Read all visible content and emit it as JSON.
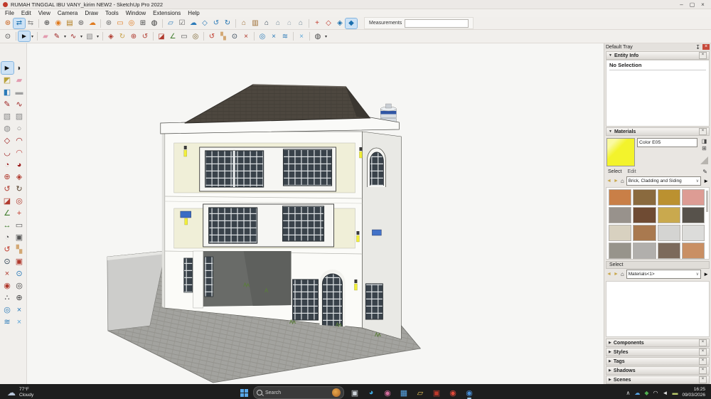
{
  "window": {
    "title": "RUMAH TINGGAL IBU VANY_kirim NEW2 - SketchUp Pro 2022",
    "controls": {
      "minimize": "–",
      "maximize": "▢",
      "close": "×"
    }
  },
  "menu": {
    "items": [
      {
        "name": "menu-file",
        "label": "File"
      },
      {
        "name": "menu-edit",
        "label": "Edit"
      },
      {
        "name": "menu-view",
        "label": "View"
      },
      {
        "name": "menu-camera",
        "label": "Camera"
      },
      {
        "name": "menu-draw",
        "label": "Draw"
      },
      {
        "name": "menu-tools",
        "label": "Tools"
      },
      {
        "name": "menu-window",
        "label": "Window"
      },
      {
        "name": "menu-extensions",
        "label": "Extensions"
      },
      {
        "name": "menu-help",
        "label": "Help"
      }
    ]
  },
  "toolbar_top": {
    "icons": [
      {
        "name": "extension-gear-icon",
        "glyph": "⊛",
        "color": "#c75b12"
      },
      {
        "name": "swap-arrows-icon",
        "glyph": "⇄",
        "color": "#1a6fae",
        "active": true
      },
      {
        "name": "send-to-layout-icon",
        "glyph": "⇆",
        "color": "#8a8a8a"
      },
      {
        "sep": true
      },
      {
        "name": "add-location-icon",
        "glyph": "⊕",
        "color": "#333333"
      },
      {
        "name": "geo-model-icon",
        "glyph": "◉",
        "color": "#e07b1f"
      },
      {
        "name": "styles-book-icon",
        "glyph": "▤",
        "color": "#b07818"
      },
      {
        "name": "model-info-icon",
        "glyph": "⊛",
        "color": "#555555"
      },
      {
        "name": "cloud-upload-icon",
        "glyph": "☁",
        "color": "#e07b1f"
      },
      {
        "sep": true
      },
      {
        "name": "manage-extensions-icon",
        "glyph": "⊛",
        "color": "#666666"
      },
      {
        "name": "feedback-chat-icon",
        "glyph": "▭",
        "color": "#e07b1f"
      },
      {
        "name": "warehouse-icon",
        "glyph": "◎",
        "color": "#e07b1f"
      },
      {
        "name": "cart-icon",
        "glyph": "⊞",
        "color": "#444444"
      },
      {
        "name": "account-icon",
        "glyph": "◍",
        "color": "#333333"
      },
      {
        "sep": true
      },
      {
        "name": "open-folder-icon",
        "glyph": "▱",
        "color": "#2a7ab8"
      },
      {
        "name": "checkbox-icon",
        "glyph": "☑",
        "color": "#666666"
      },
      {
        "name": "cloud-download-icon",
        "glyph": "☁",
        "color": "#2a7ab8"
      },
      {
        "name": "cloud-box-icon",
        "glyph": "◇",
        "color": "#2a7ab8"
      },
      {
        "name": "cloud-sync-icon",
        "glyph": "↺",
        "color": "#2a7ab8"
      },
      {
        "name": "refresh-icon",
        "glyph": "↻",
        "color": "#1a6fae"
      },
      {
        "sep": true
      },
      {
        "name": "textured-house-icon",
        "glyph": "⌂",
        "color": "#9c6a2f"
      },
      {
        "name": "component-book-icon",
        "glyph": "▥",
        "color": "#9c6a2f"
      },
      {
        "name": "house-solid-icon",
        "glyph": "⌂",
        "color": "#2c3e50"
      },
      {
        "name": "house-roof-icon",
        "glyph": "⌂",
        "color": "#6f8797"
      },
      {
        "name": "house-outline-icon",
        "glyph": "⌂",
        "color": "#9aa7b0"
      },
      {
        "name": "house-flat-icon",
        "glyph": "⌂",
        "color": "#6f8797"
      },
      {
        "sep": true
      },
      {
        "name": "axes-icon",
        "glyph": "+",
        "color": "#c0392b"
      },
      {
        "name": "face-wireframe-icon",
        "glyph": "◇",
        "color": "#c0392b"
      },
      {
        "name": "face-shaded-icon",
        "glyph": "◈",
        "color": "#1a6fae"
      },
      {
        "name": "face-textured-icon",
        "glyph": "◆",
        "color": "#1a6fae",
        "active": true
      }
    ],
    "measurements_label": "Measurements",
    "measurements_value": ""
  },
  "toolbar_second": {
    "icons": [
      {
        "name": "zoom-tool-icon",
        "glyph": "⊙",
        "color": "#444444"
      },
      {
        "sep": true
      },
      {
        "name": "select-arrow-icon",
        "glyph": "►",
        "color": "#111111",
        "active": true
      },
      {
        "name": "select-caret-icon",
        "glyph": "▾",
        "color": "#333333",
        "small": true
      },
      {
        "sep": true
      },
      {
        "name": "eraser-icon",
        "glyph": "▰",
        "color": "#e39cb0"
      },
      {
        "name": "pencil-icon",
        "glyph": "✎",
        "color": "#9b1c1c"
      },
      {
        "name": "pencil-caret-icon",
        "glyph": "▾",
        "color": "#333333",
        "small": true
      },
      {
        "name": "freehand-icon",
        "glyph": "∿",
        "color": "#9b1c1c"
      },
      {
        "name": "freehand-caret-icon",
        "glyph": "▾",
        "color": "#333333",
        "small": true
      },
      {
        "name": "rectangle-icon",
        "glyph": "▧",
        "color": "#8a8a8a"
      },
      {
        "name": "rectangle-caret-icon",
        "glyph": "▾",
        "color": "#333333",
        "small": true
      },
      {
        "sep": true
      },
      {
        "name": "pushpull-icon",
        "glyph": "◈",
        "color": "#b03a2e"
      },
      {
        "name": "followme-icon",
        "glyph": "↻",
        "color": "#c8a24a"
      },
      {
        "name": "move-icon",
        "glyph": "⊕",
        "color": "#b03a2e"
      },
      {
        "name": "rotate-icon",
        "glyph": "↺",
        "color": "#b03a2e"
      },
      {
        "sep": true
      },
      {
        "name": "scale-icon",
        "glyph": "◪",
        "color": "#b03a2e"
      },
      {
        "name": "tape-measure-icon",
        "glyph": "∠",
        "color": "#3f7d2c"
      },
      {
        "name": "text-label-icon",
        "glyph": "▭",
        "color": "#555555"
      },
      {
        "name": "binoculars-icon",
        "glyph": "◎",
        "color": "#7a6430"
      },
      {
        "sep": true
      },
      {
        "name": "orbit-icon",
        "glyph": "↺",
        "color": "#c0392b"
      },
      {
        "name": "pan-icon",
        "glyph": "▚",
        "color": "#d3a874"
      },
      {
        "name": "zoom-icon",
        "glyph": "⊙",
        "color": "#2c3e50"
      },
      {
        "name": "zoom-extents-icon",
        "glyph": "×",
        "color": "#b03a2e"
      },
      {
        "sep": true
      },
      {
        "name": "zoom-selection-icon",
        "glyph": "◎",
        "color": "#2a7ab8"
      },
      {
        "name": "section-tool-icon",
        "glyph": "×",
        "color": "#2a7ab8"
      },
      {
        "name": "layers-stack-icon",
        "glyph": "≋",
        "color": "#2a7ab8"
      },
      {
        "sep": true
      },
      {
        "name": "section-fill-icon",
        "glyph": "×",
        "color": "#5da6d8"
      },
      {
        "sep": true
      },
      {
        "name": "account-menu-icon",
        "glyph": "◍",
        "color": "#444444"
      },
      {
        "name": "account-caret-icon",
        "glyph": "▾",
        "color": "#333333",
        "small": true
      }
    ]
  },
  "left_toolbar": {
    "icons": [
      {
        "name": "select-arrow-icon",
        "glyph": "►",
        "color": "#111111",
        "active": true
      },
      {
        "name": "lasso-select-icon",
        "glyph": "◗",
        "color": "#333333"
      },
      {
        "name": "paint-bucket-icon",
        "glyph": "◩",
        "color": "#b9a23a"
      },
      {
        "name": "eraser-icon",
        "glyph": "▰",
        "color": "#e39cb0"
      },
      {
        "name": "sample-paint-icon",
        "glyph": "◧",
        "color": "#2a7ab8"
      },
      {
        "name": "soft-eraser-icon",
        "glyph": "▬",
        "color": "#a0a0a0"
      },
      {
        "name": "line-icon",
        "glyph": "✎",
        "color": "#9b1c1c"
      },
      {
        "name": "freehand-icon",
        "glyph": "∿",
        "color": "#9b1c1c"
      },
      {
        "name": "rectangle-icon",
        "glyph": "▧",
        "color": "#8a8a8a"
      },
      {
        "name": "rotated-rectangle-icon",
        "glyph": "▨",
        "color": "#8a8a8a"
      },
      {
        "name": "circle-icon",
        "glyph": "◍",
        "color": "#8a8a8a"
      },
      {
        "name": "ellipse-icon",
        "glyph": "○",
        "color": "#8a8a8a"
      },
      {
        "name": "polygon-icon",
        "glyph": "◇",
        "color": "#9b1c1c"
      },
      {
        "name": "arc-icon",
        "glyph": "◠",
        "color": "#9b1c1c"
      },
      {
        "name": "two-point-arc-icon",
        "glyph": "◡",
        "color": "#9b1c1c"
      },
      {
        "name": "three-point-arc-icon",
        "glyph": "◠",
        "color": "#c0504d"
      },
      {
        "name": "pie-icon",
        "glyph": "◔",
        "color": "#9b1c1c"
      },
      {
        "name": "sector-icon",
        "glyph": "◕",
        "color": "#9b1c1c"
      },
      {
        "name": "move-icon",
        "glyph": "⊕",
        "color": "#b03a2e"
      },
      {
        "name": "pushpull-icon",
        "glyph": "◈",
        "color": "#b03a2e"
      },
      {
        "name": "rotate-icon",
        "glyph": "↺",
        "color": "#b03a2e"
      },
      {
        "name": "followme-icon",
        "glyph": "↻",
        "color": "#5a4632"
      },
      {
        "name": "scale-icon",
        "glyph": "◪",
        "color": "#b03a2e"
      },
      {
        "name": "offset-icon",
        "glyph": "◎",
        "color": "#b03a2e"
      },
      {
        "name": "tape-measure-icon",
        "glyph": "∠",
        "color": "#3f7d2c"
      },
      {
        "name": "axes-tool-icon",
        "glyph": "+",
        "color": "#c0392b"
      },
      {
        "name": "dimension-icon",
        "glyph": "↔",
        "color": "#3f7d2c"
      },
      {
        "name": "text-label-icon",
        "glyph": "▭",
        "color": "#555555"
      },
      {
        "name": "protractor-icon",
        "glyph": "◔",
        "color": "#555555"
      },
      {
        "name": "threed-text-icon",
        "glyph": "▣",
        "color": "#555555"
      },
      {
        "name": "orbit-icon",
        "glyph": "↺",
        "color": "#c0392b"
      },
      {
        "name": "pan-icon",
        "glyph": "▚",
        "color": "#d3a874"
      },
      {
        "name": "zoom-tool-icon",
        "glyph": "⊙",
        "color": "#2c3e50"
      },
      {
        "name": "zoom-window-icon",
        "glyph": "▣",
        "color": "#b03a2e"
      },
      {
        "name": "zoom-extents-icon",
        "glyph": "×",
        "color": "#b03a2e"
      },
      {
        "name": "previous-zoom-icon",
        "glyph": "⊙",
        "color": "#2a7ab8"
      },
      {
        "name": "position-camera-icon",
        "glyph": "◉",
        "color": "#b03a2e"
      },
      {
        "name": "look-around-icon",
        "glyph": "◎",
        "color": "#444444"
      },
      {
        "name": "walk-icon",
        "glyph": "∴",
        "color": "#333333"
      },
      {
        "name": "target-icon",
        "glyph": "⊕",
        "color": "#444444"
      },
      {
        "name": "section-plane-icon",
        "glyph": "◎",
        "color": "#2a7ab8"
      },
      {
        "name": "section-x-icon",
        "glyph": "×",
        "color": "#2a7ab8"
      },
      {
        "name": "layers-stack-icon",
        "glyph": "≋",
        "color": "#2a7ab8"
      },
      {
        "name": "section-fill-icon",
        "glyph": "×",
        "color": "#5da6d8"
      }
    ]
  },
  "canvas": {
    "description": "3D model of a three-story cream house with dark hip roof, carport, arched entry door, rooftop water tank and paved driveway",
    "colors": {
      "background": "#f6f6f4",
      "roof": "#4d473f",
      "wall_cream": "#f0efd8",
      "wall_white": "#fbfbf8",
      "window_dark": "#39424a",
      "driveway": "#a3a39f",
      "carport_shadow": "#696b68",
      "side_wall": "#cdcdcb",
      "tank_blue": "#2f55a4",
      "lamp_yellow": "#f2ef3a",
      "ac_blue": "#3a6bc4",
      "grass": "#5a7d3a"
    }
  },
  "tray": {
    "title": "Default Tray",
    "glyphs": {
      "pin": "↧",
      "close": "×",
      "expanded": "▼",
      "collapsed": "▶",
      "back": "◄",
      "forward": "►",
      "home": "⌂",
      "detail": "►",
      "dropdown": "∨",
      "display_pane": "◨",
      "create_material": "⊞",
      "eyedropper": "✎"
    },
    "entity_info": {
      "title": "Entity Info",
      "status": "No Selection"
    },
    "materials": {
      "title": "Materials",
      "active_color": "#f3f32c",
      "name_value": "Color E05",
      "select_tab": "Select",
      "edit_tab": "Edit",
      "collection": "Brick, Cladding and Siding",
      "select_header": "Select",
      "in_model_collection": "Materials<1>",
      "swatches": [
        {
          "name": "swatch-orange-siding",
          "color": "#c97f47"
        },
        {
          "name": "swatch-speckled-brown",
          "color": "#8a6a3e"
        },
        {
          "name": "swatch-gold-stucco",
          "color": "#bb9130"
        },
        {
          "name": "swatch-pink-stucco",
          "color": "#dd9c94"
        },
        {
          "name": "swatch-gray-stone",
          "color": "#98928c"
        },
        {
          "name": "swatch-dark-brick",
          "color": "#6f4b33"
        },
        {
          "name": "swatch-tan-brick",
          "color": "#c9a94e"
        },
        {
          "name": "swatch-gray-brick",
          "color": "#57524b"
        },
        {
          "name": "swatch-cream-siding",
          "color": "#d8d1c0"
        },
        {
          "name": "swatch-brown-siding",
          "color": "#a9794f"
        },
        {
          "name": "swatch-light-gray-panel",
          "color": "#d4d4d2"
        },
        {
          "name": "swatch-white-panel",
          "color": "#dcdcda"
        },
        {
          "name": "swatch-gray-pavers",
          "color": "#97948b"
        },
        {
          "name": "swatch-striped-gray",
          "color": "#b1afac"
        },
        {
          "name": "swatch-walnut-brick",
          "color": "#7c6a5b"
        },
        {
          "name": "swatch-terracotta-siding",
          "color": "#c98f63"
        }
      ]
    },
    "collapsed_panels": [
      {
        "name": "panel-components",
        "title": "Components"
      },
      {
        "name": "panel-styles",
        "title": "Styles"
      },
      {
        "name": "panel-tags",
        "title": "Tags"
      },
      {
        "name": "panel-shadows",
        "title": "Shadows"
      },
      {
        "name": "panel-scenes",
        "title": "Scenes"
      }
    ]
  },
  "taskbar": {
    "weather": {
      "temp": "77°F",
      "condition": "Cloudy"
    },
    "search_label": "Search",
    "apps": [
      {
        "name": "task-view-icon",
        "glyph": "▣",
        "color": "#cfd4da"
      },
      {
        "name": "edge-icon",
        "glyph": "◕",
        "color": "#3fa7dd"
      },
      {
        "name": "copilot-icon",
        "glyph": "◉",
        "color": "#d86fa0"
      },
      {
        "name": "store-icon",
        "glyph": "▦",
        "color": "#58a6e8"
      },
      {
        "name": "file-explorer-icon",
        "glyph": "▱",
        "color": "#e8c35a"
      },
      {
        "name": "layout-app-icon",
        "glyph": "▣",
        "color": "#c0392b"
      },
      {
        "name": "chrome-icon",
        "glyph": "◉",
        "color": "#e0493a"
      },
      {
        "name": "sketchup-app-icon",
        "glyph": "◉",
        "color": "#4a90d9",
        "active": true
      }
    ],
    "tray_icons": [
      {
        "name": "chevron-up-icon",
        "glyph": "∧",
        "color": "#dcdcdc"
      },
      {
        "name": "onedrive-icon",
        "glyph": "☁",
        "color": "#58a6e8"
      },
      {
        "name": "defender-icon",
        "glyph": "◆",
        "color": "#4fae4f"
      },
      {
        "name": "wifi-icon",
        "glyph": "◠",
        "color": "#e0e0e0"
      },
      {
        "name": "volume-icon",
        "glyph": "◄",
        "color": "#e0e0e0"
      },
      {
        "name": "battery-icon",
        "glyph": "▬",
        "color": "#b9c96a"
      }
    ],
    "clock": {
      "time": "16:25",
      "date": "09/03/2026"
    }
  }
}
